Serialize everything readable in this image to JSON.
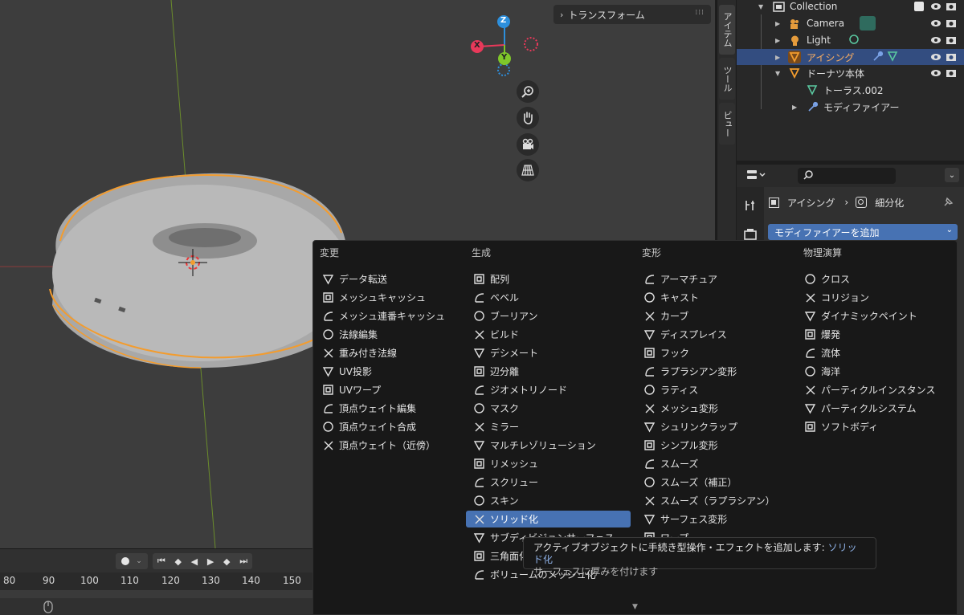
{
  "viewport": {
    "transform_panel_label": "トランスフォーム",
    "gizmo": {
      "x": "X",
      "y": "Y",
      "z": "Z"
    },
    "nav_buttons": [
      "zoom-icon",
      "hand-icon",
      "camera-icon",
      "grid-icon"
    ]
  },
  "side_tabs": [
    "アイテム",
    "ツール",
    "ビュー"
  ],
  "outliner": {
    "rows": [
      {
        "label": "Collection"
      },
      {
        "label": "Camera"
      },
      {
        "label": "Light"
      },
      {
        "label": "アイシング"
      },
      {
        "label": "ドーナツ本体"
      },
      {
        "label": "トーラス.002"
      },
      {
        "label": "モディファイアー"
      }
    ]
  },
  "properties": {
    "breadcrumb": {
      "object": "アイシング",
      "modifier": "細分化"
    },
    "add_modifier_label": "モディファイアーを追加"
  },
  "timeline": {
    "frame_numbers": [
      "80",
      "90",
      "100",
      "110",
      "120",
      "130",
      "140",
      "150"
    ]
  },
  "add_menu": {
    "columns": [
      {
        "title": "変更",
        "items": [
          "データ転送",
          "メッシュキャッシュ",
          "メッシュ連番キャッシュ",
          "法線編集",
          "重み付き法線",
          "UV投影",
          "UVワープ",
          "頂点ウェイト編集",
          "頂点ウェイト合成",
          "頂点ウェイト（近傍）"
        ]
      },
      {
        "title": "生成",
        "items": [
          "配列",
          "ベベル",
          "ブーリアン",
          "ビルド",
          "デシメート",
          "辺分離",
          "ジオメトリノード",
          "マスク",
          "ミラー",
          "マルチレゾリューション",
          "リメッシュ",
          "スクリュー",
          "スキン",
          "ソリッド化",
          "サブディビジョンサーフェス",
          "三角面化",
          "ボリュームのメッシュ化"
        ]
      },
      {
        "title": "変形",
        "items": [
          "アーマチュア",
          "キャスト",
          "カーブ",
          "ディスプレイス",
          "フック",
          "ラプラシアン変形",
          "ラティス",
          "メッシュ変形",
          "シュリンクラップ",
          "シンプル変形",
          "スムーズ",
          "スムーズ（補正）",
          "スムーズ（ラプラシアン）",
          "サーフェス変形",
          "ワープ"
        ]
      },
      {
        "title": "物理演算",
        "items": [
          "クロス",
          "コリジョン",
          "ダイナミックペイント",
          "爆発",
          "流体",
          "海洋",
          "パーティクルインスタンス",
          "パーティクルシステム",
          "ソフトボディ"
        ]
      }
    ],
    "highlighted_item": "ソリッド化"
  },
  "tooltip": {
    "line1_prefix": "アクティブオブジェクトに手続き型操作・エフェクトを追加します:",
    "line1_highlight": "ソリッド化",
    "line2": "サーフェスに厚みを付けます"
  },
  "colors": {
    "accent": "#4772b3",
    "selection_outline": "#f39c2e",
    "axis_x": "#e8395a",
    "axis_y": "#7fc72a",
    "axis_z": "#2d8fdc"
  }
}
